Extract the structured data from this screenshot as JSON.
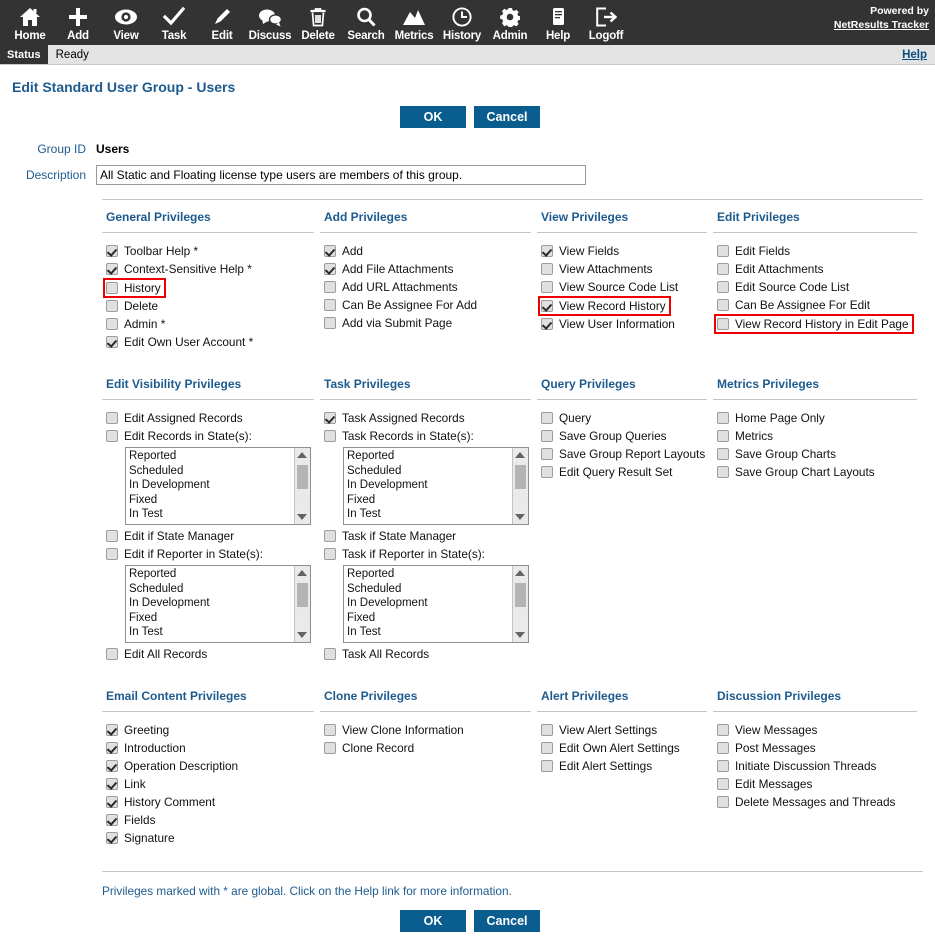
{
  "toolbar": {
    "items": [
      {
        "label": "Home",
        "icon": "home-icon"
      },
      {
        "label": "Add",
        "icon": "plus-icon"
      },
      {
        "label": "View",
        "icon": "eye-icon"
      },
      {
        "label": "Task",
        "icon": "check-icon"
      },
      {
        "label": "Edit",
        "icon": "pencil-icon"
      },
      {
        "label": "Discuss",
        "icon": "speech-bubbles-icon"
      },
      {
        "label": "Delete",
        "icon": "trash-icon"
      },
      {
        "label": "Search",
        "icon": "magnifier-icon"
      },
      {
        "label": "Metrics",
        "icon": "chart-icon"
      },
      {
        "label": "History",
        "icon": "clock-icon"
      },
      {
        "label": "Admin",
        "icon": "gear-icon"
      },
      {
        "label": "Help",
        "icon": "document-icon"
      },
      {
        "label": "Logoff",
        "icon": "exit-icon"
      }
    ],
    "powered_by": "Powered by",
    "brand": "NetResults Tracker"
  },
  "statusbar": {
    "tag": "Status",
    "text": "Ready",
    "help": "Help"
  },
  "page": {
    "title": "Edit Standard User Group - Users",
    "ok_label": "OK",
    "cancel_label": "Cancel",
    "group_id_label": "Group ID",
    "group_id_value": "Users",
    "description_label": "Description",
    "description_value": "All Static and Floating license type users are members of this group.",
    "footnote": "Privileges marked with * are global. Click on the Help link for more information."
  },
  "colors": {
    "accent": "#0a5d8f",
    "heading": "#1d5b8f",
    "toolbar_bg": "#333333",
    "highlight": "#ee0000"
  },
  "states_list": [
    "Reported",
    "Scheduled",
    "In Development",
    "Fixed",
    "In Test"
  ],
  "sections": {
    "general": {
      "title": "General Privileges",
      "items": [
        {
          "label": "Toolbar Help *",
          "checked": true,
          "highlight": false
        },
        {
          "label": "Context-Sensitive Help *",
          "checked": true,
          "highlight": false
        },
        {
          "label": "History",
          "checked": false,
          "highlight": true
        },
        {
          "label": "Delete",
          "checked": false,
          "highlight": false
        },
        {
          "label": "Admin *",
          "checked": false,
          "highlight": false
        },
        {
          "label": "Edit Own User Account *",
          "checked": true,
          "highlight": false
        }
      ]
    },
    "add": {
      "title": "Add Privileges",
      "items": [
        {
          "label": "Add",
          "checked": true,
          "highlight": false
        },
        {
          "label": "Add File Attachments",
          "checked": true,
          "highlight": false
        },
        {
          "label": "Add URL Attachments",
          "checked": false,
          "highlight": false
        },
        {
          "label": "Can Be Assignee For Add",
          "checked": false,
          "highlight": false
        },
        {
          "label": "Add via Submit Page",
          "checked": false,
          "highlight": false
        }
      ]
    },
    "view": {
      "title": "View Privileges",
      "items": [
        {
          "label": "View Fields",
          "checked": true,
          "highlight": false
        },
        {
          "label": "View Attachments",
          "checked": false,
          "highlight": false
        },
        {
          "label": "View Source Code List",
          "checked": false,
          "highlight": false
        },
        {
          "label": "View Record History",
          "checked": true,
          "highlight": true
        },
        {
          "label": "View User Information",
          "checked": true,
          "highlight": false
        }
      ]
    },
    "edit": {
      "title": "Edit Privileges",
      "items": [
        {
          "label": "Edit Fields",
          "checked": false,
          "highlight": false
        },
        {
          "label": "Edit Attachments",
          "checked": false,
          "highlight": false
        },
        {
          "label": "Edit Source Code List",
          "checked": false,
          "highlight": false
        },
        {
          "label": "Can Be Assignee For Edit",
          "checked": false,
          "highlight": false
        },
        {
          "label": "View Record History in Edit Page",
          "checked": false,
          "highlight": true
        }
      ]
    },
    "edit_visibility": {
      "title": "Edit Visibility Privileges",
      "items": [
        {
          "label": "Edit Assigned Records",
          "checked": false
        },
        {
          "label": "Edit Records in State(s):",
          "checked": false,
          "list": true
        },
        {
          "label": "Edit if State Manager",
          "checked": false
        },
        {
          "label": "Edit if Reporter in State(s):",
          "checked": false,
          "list": true
        },
        {
          "label": "Edit All Records",
          "checked": false
        }
      ]
    },
    "task": {
      "title": "Task Privileges",
      "items": [
        {
          "label": "Task Assigned Records",
          "checked": true
        },
        {
          "label": "Task Records in State(s):",
          "checked": false,
          "list": true
        },
        {
          "label": "Task if State Manager",
          "checked": false
        },
        {
          "label": "Task if Reporter in State(s):",
          "checked": false,
          "list": true
        },
        {
          "label": "Task All Records",
          "checked": false
        }
      ]
    },
    "query": {
      "title": "Query Privileges",
      "items": [
        {
          "label": "Query",
          "checked": false
        },
        {
          "label": "Save Group Queries",
          "checked": false
        },
        {
          "label": "Save Group Report Layouts",
          "checked": false
        },
        {
          "label": "Edit Query Result Set",
          "checked": false
        }
      ]
    },
    "metrics": {
      "title": "Metrics Privileges",
      "items": [
        {
          "label": "Home Page Only",
          "checked": false
        },
        {
          "label": "Metrics",
          "checked": false
        },
        {
          "label": "Save Group Charts",
          "checked": false
        },
        {
          "label": "Save Group Chart Layouts",
          "checked": false
        }
      ]
    },
    "email_content": {
      "title": "Email Content Privileges",
      "items": [
        {
          "label": "Greeting",
          "checked": true
        },
        {
          "label": "Introduction",
          "checked": true
        },
        {
          "label": "Operation Description",
          "checked": true
        },
        {
          "label": "Link",
          "checked": true
        },
        {
          "label": "History Comment",
          "checked": true
        },
        {
          "label": "Fields",
          "checked": true
        },
        {
          "label": "Signature",
          "checked": true
        }
      ]
    },
    "clone": {
      "title": "Clone Privileges",
      "items": [
        {
          "label": "View Clone Information",
          "checked": false
        },
        {
          "label": "Clone Record",
          "checked": false
        }
      ]
    },
    "alert": {
      "title": "Alert Privileges",
      "items": [
        {
          "label": "View Alert Settings",
          "checked": false
        },
        {
          "label": "Edit Own Alert Settings",
          "checked": false
        },
        {
          "label": "Edit Alert Settings",
          "checked": false
        }
      ]
    },
    "discussion": {
      "title": "Discussion Privileges",
      "items": [
        {
          "label": "View Messages",
          "checked": false
        },
        {
          "label": "Post Messages",
          "checked": false
        },
        {
          "label": "Initiate Discussion Threads",
          "checked": false
        },
        {
          "label": "Edit Messages",
          "checked": false
        },
        {
          "label": "Delete Messages and Threads",
          "checked": false
        }
      ]
    }
  }
}
